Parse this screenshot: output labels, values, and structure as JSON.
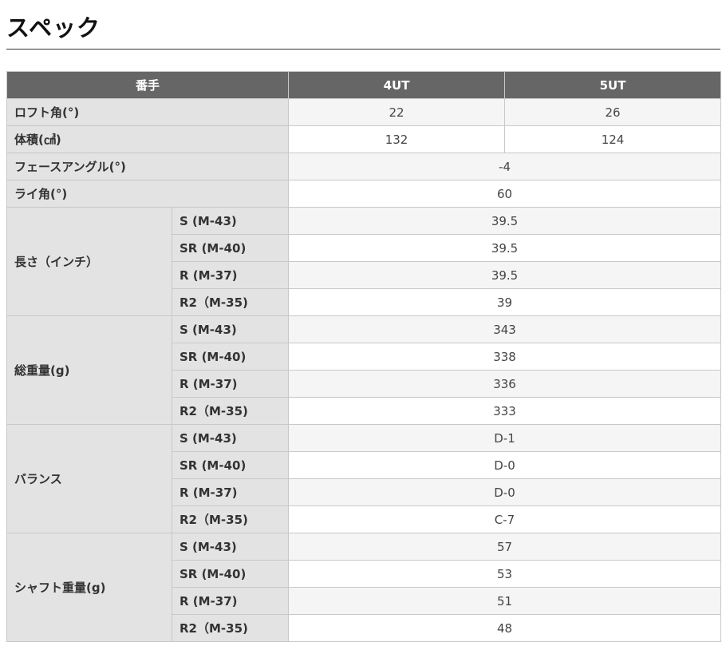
{
  "title": "スペック",
  "header": {
    "label": "番手",
    "models": [
      "4UT",
      "5UT"
    ]
  },
  "rows": {
    "loft": {
      "label": "ロフト角(°)",
      "v4": "22",
      "v5": "26"
    },
    "volume": {
      "label": "体積(㎤)",
      "v4": "132",
      "v5": "124"
    },
    "face_angle": {
      "label": "フェースアングル(°)",
      "value": "-4"
    },
    "lie": {
      "label": "ライ角(°)",
      "value": "60"
    }
  },
  "groups": [
    {
      "label": "長さ（インチ）",
      "items": [
        {
          "flex": "S (M-43)",
          "value": "39.5"
        },
        {
          "flex": "SR (M-40)",
          "value": "39.5"
        },
        {
          "flex": "R (M-37)",
          "value": "39.5"
        },
        {
          "flex": "R2（M-35)",
          "value": "39"
        }
      ]
    },
    {
      "label": "総重量(g)",
      "items": [
        {
          "flex": "S (M-43)",
          "value": "343"
        },
        {
          "flex": "SR (M-40)",
          "value": "338"
        },
        {
          "flex": "R (M-37)",
          "value": "336"
        },
        {
          "flex": "R2（M-35)",
          "value": "333"
        }
      ]
    },
    {
      "label": "バランス",
      "items": [
        {
          "flex": "S (M-43)",
          "value": "D-1"
        },
        {
          "flex": "SR (M-40)",
          "value": "D-0"
        },
        {
          "flex": "R (M-37)",
          "value": "D-0"
        },
        {
          "flex": "R2（M-35)",
          "value": "C-7"
        }
      ]
    },
    {
      "label": "シャフト重量(g)",
      "items": [
        {
          "flex": "S (M-43)",
          "value": "57"
        },
        {
          "flex": "SR (M-40)",
          "value": "53"
        },
        {
          "flex": "R (M-37)",
          "value": "51"
        },
        {
          "flex": "R2（M-35)",
          "value": "48"
        }
      ]
    }
  ]
}
